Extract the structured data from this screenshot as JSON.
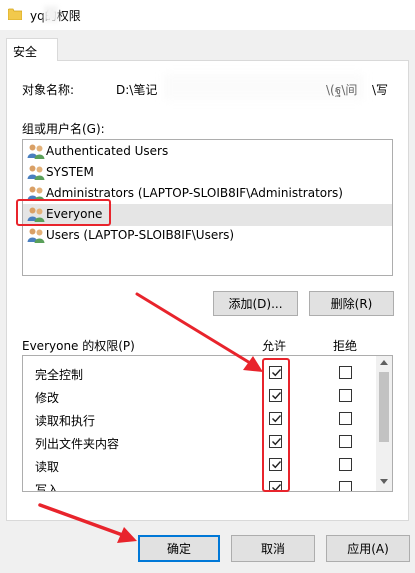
{
  "window": {
    "title": "yq的权限"
  },
  "tabs": [
    {
      "label": "安全"
    }
  ],
  "object": {
    "label": "对象名称:",
    "value": "D:\\笔记",
    "tail_mid": "\\(ฐ\\间",
    "tail_end": "\\写"
  },
  "groups": {
    "label": "组或用户名(G):",
    "items": [
      {
        "label": "Authenticated Users",
        "selected": false
      },
      {
        "label": "SYSTEM",
        "selected": false
      },
      {
        "label": "Administrators (LAPTOP-SLOIB8IF\\Administrators)",
        "selected": false
      },
      {
        "label": "Everyone",
        "selected": true
      },
      {
        "label": "Users (LAPTOP-SLOIB8IF\\Users)",
        "selected": false
      }
    ],
    "add_label": "添加(D)...",
    "remove_label": "删除(R)"
  },
  "permissions": {
    "title": "Everyone 的权限(P)",
    "allow_header": "允许",
    "deny_header": "拒绝",
    "items": [
      {
        "name": "完全控制",
        "allow": true,
        "deny": false
      },
      {
        "name": "修改",
        "allow": true,
        "deny": false
      },
      {
        "name": "读取和执行",
        "allow": true,
        "deny": false
      },
      {
        "name": "列出文件夹内容",
        "allow": true,
        "deny": false
      },
      {
        "name": "读取",
        "allow": true,
        "deny": false
      },
      {
        "name": "写入",
        "allow": true,
        "deny": false
      }
    ]
  },
  "footer": {
    "ok_label": "确定",
    "cancel_label": "取消",
    "apply_label": "应用(A)"
  },
  "colors": {
    "highlight": "#e8242c",
    "accent": "#0078d7"
  },
  "icons": {
    "folder": "folder-icon",
    "users": "users-icon",
    "check": "check-icon"
  }
}
